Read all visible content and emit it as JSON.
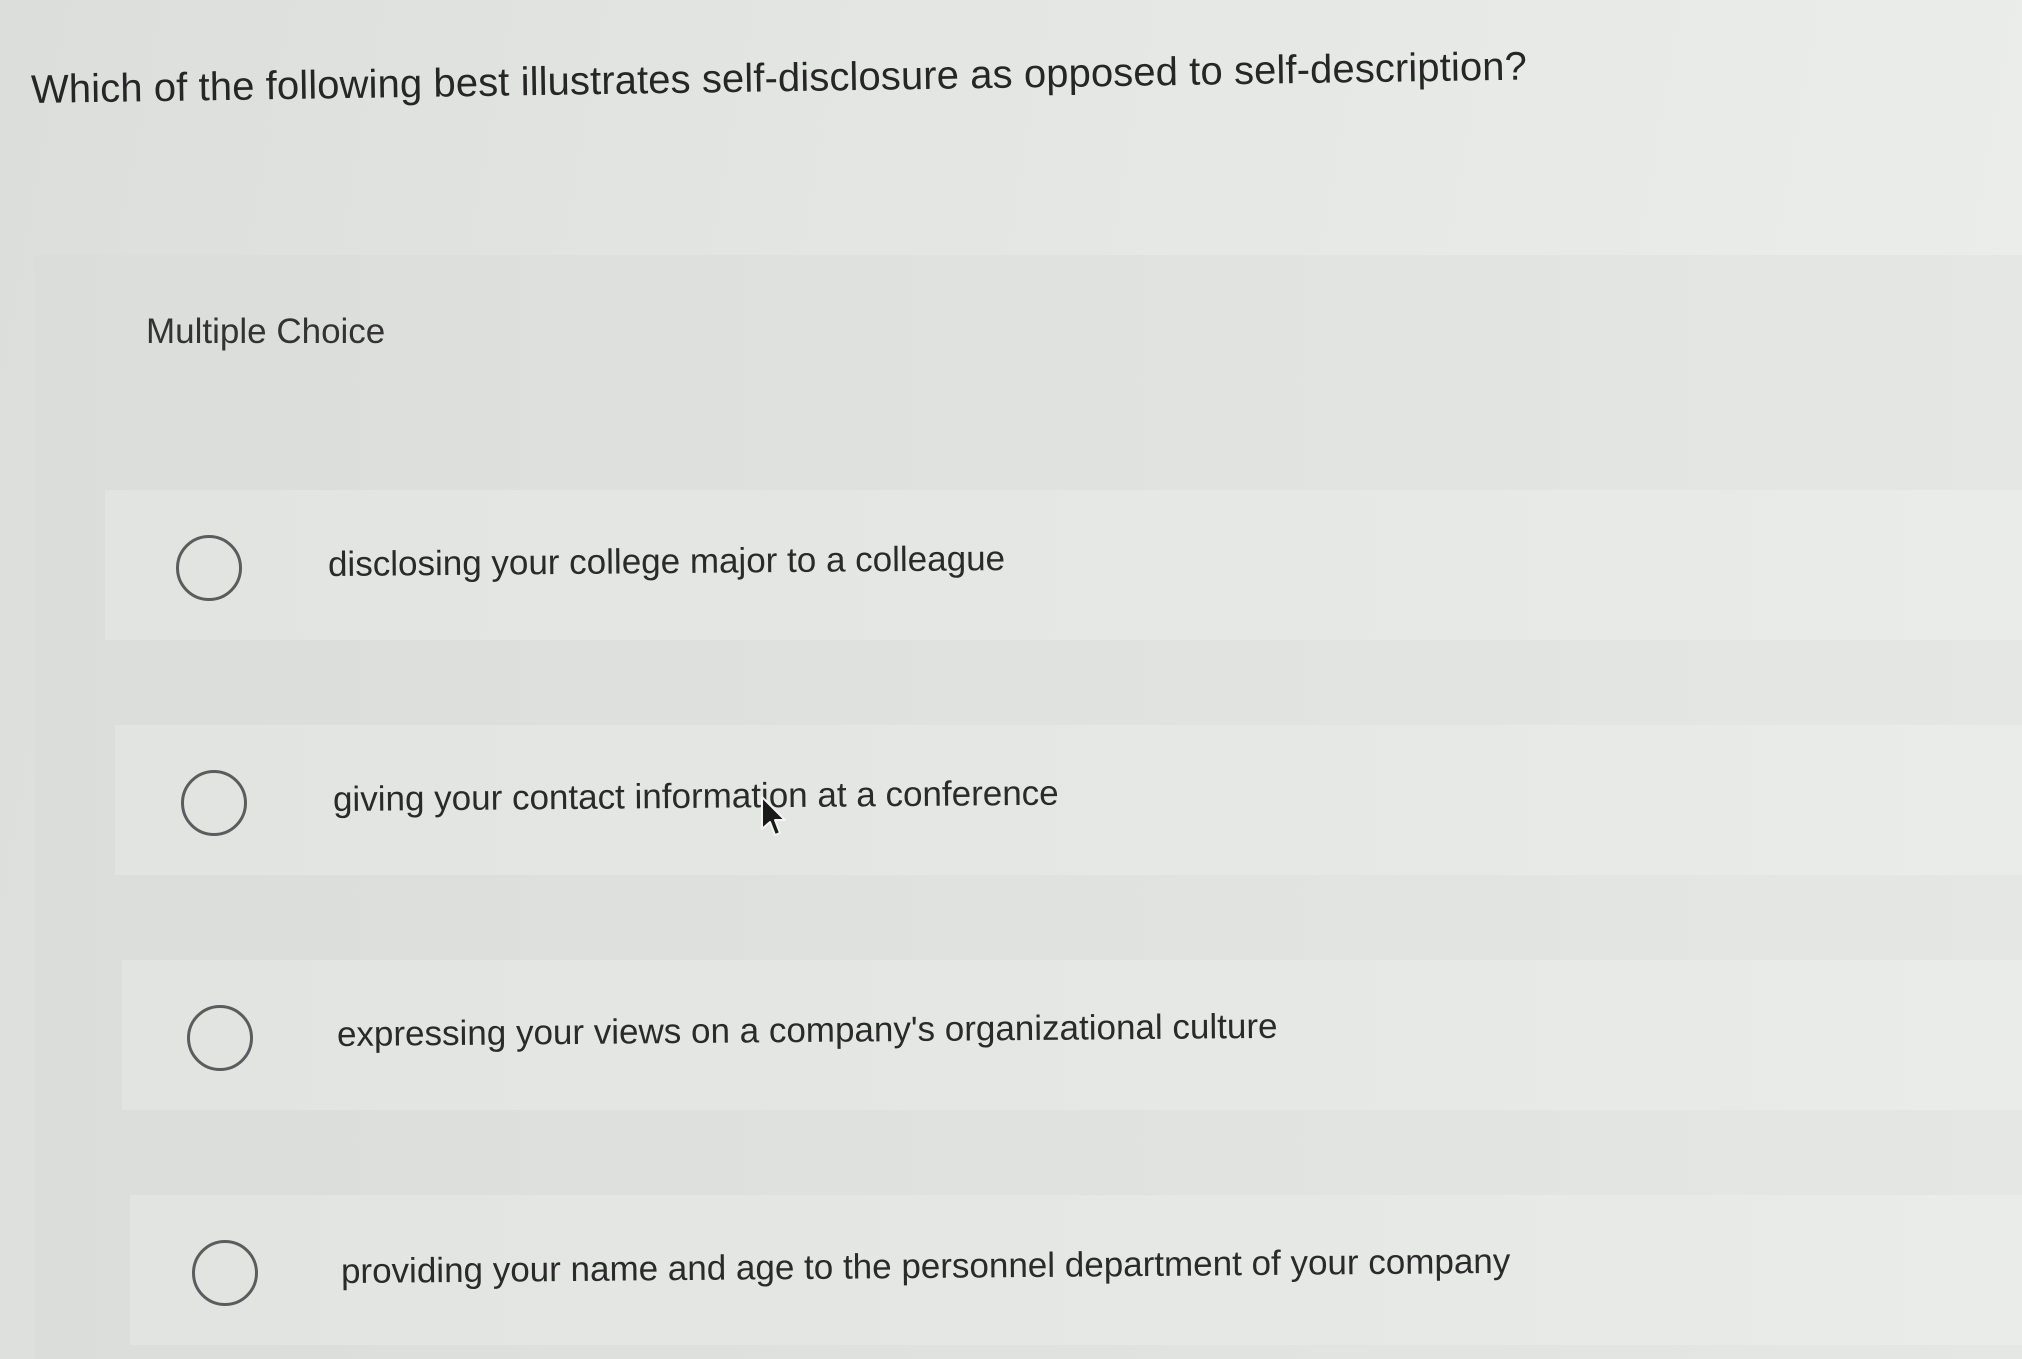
{
  "question": "Which of the following best illustrates self-disclosure as opposed to self-description?",
  "type_label": "Multiple Choice",
  "options": [
    {
      "label": "disclosing your college major to a colleague"
    },
    {
      "label": "giving your contact information at a conference"
    },
    {
      "label": "expressing your views on a company's organizational culture"
    },
    {
      "label": "providing your name and age to the personnel department of your company"
    }
  ],
  "icons": {
    "radio": "radio-unselected-icon",
    "cursor": "mouse-pointer-icon"
  }
}
